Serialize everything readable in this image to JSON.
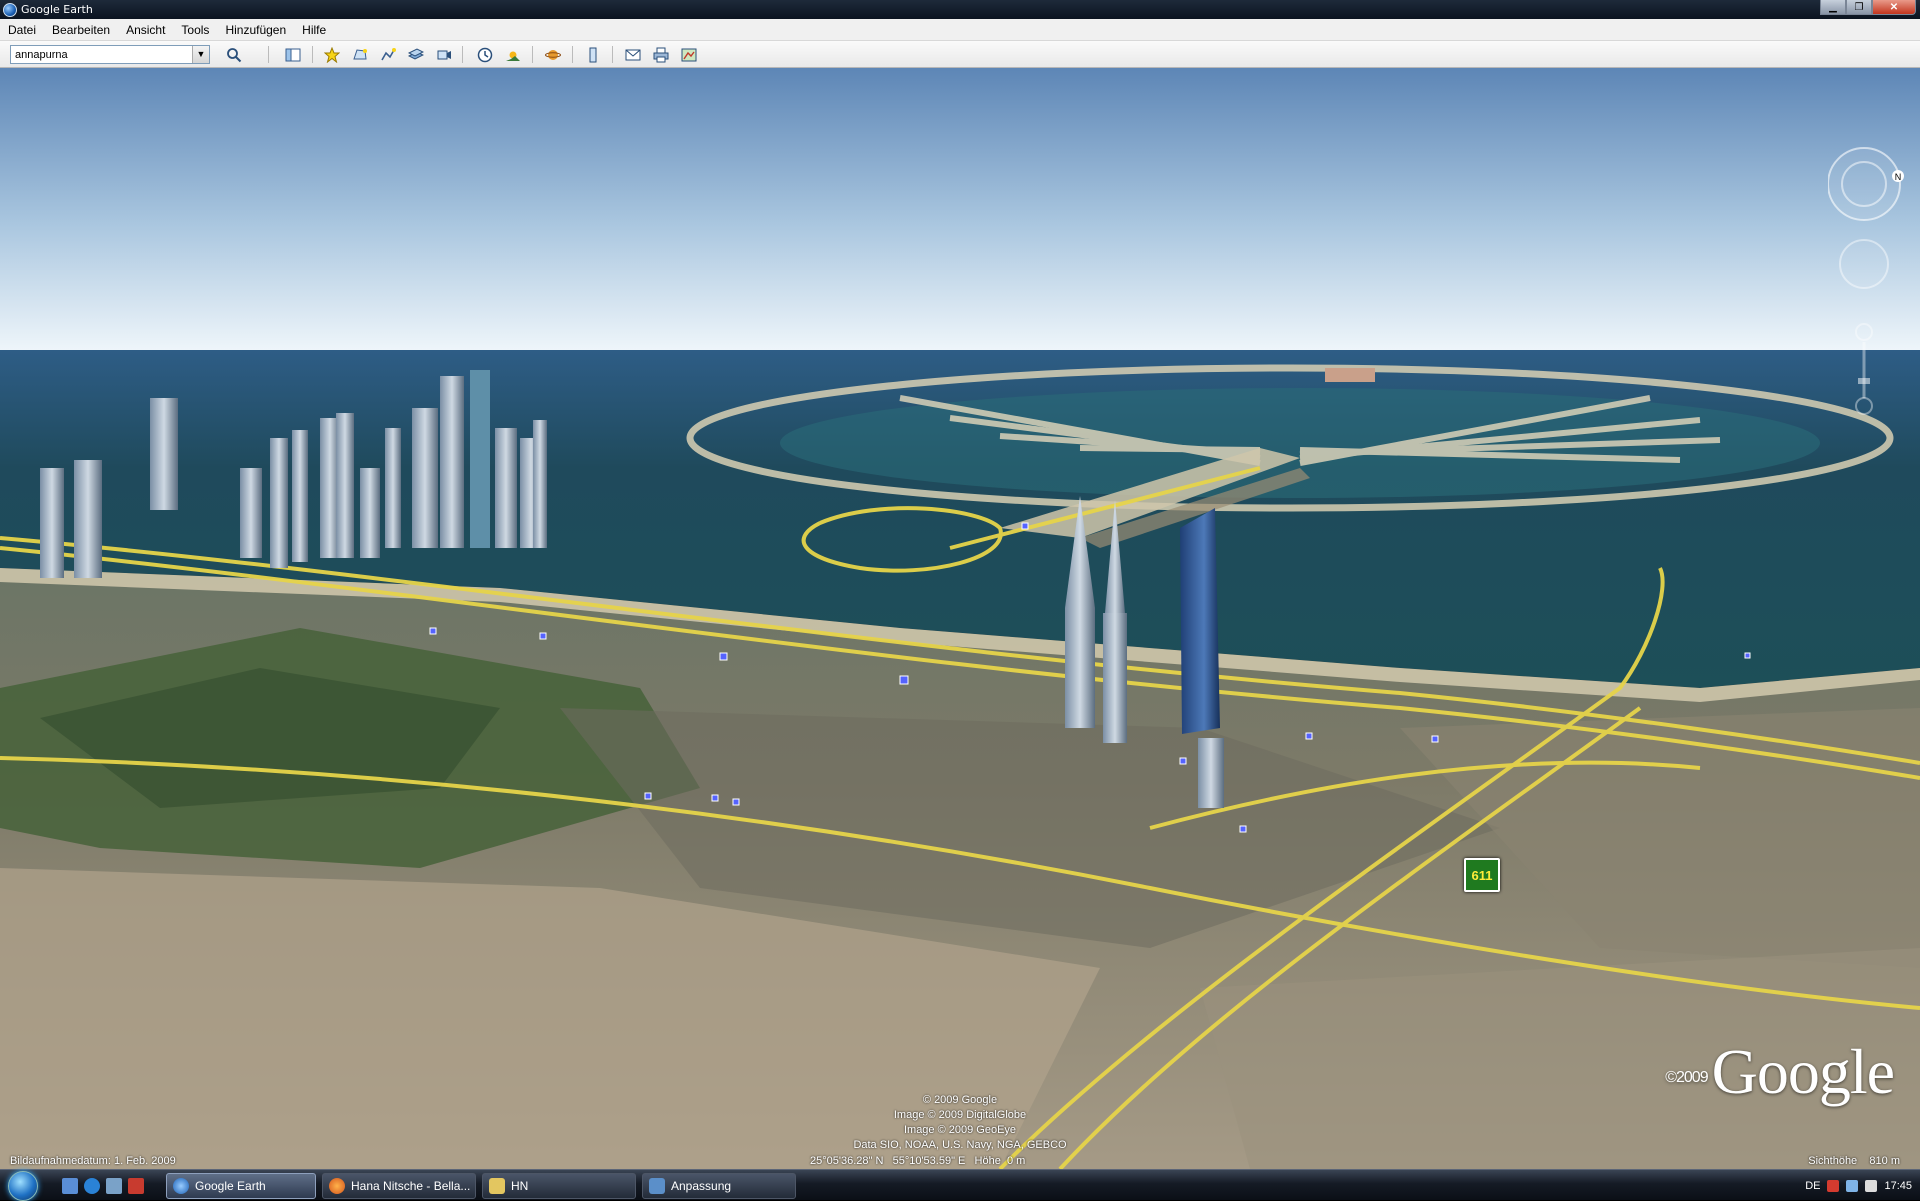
{
  "window": {
    "title": "Google Earth",
    "buttons": {
      "minimize": "▁",
      "restore": "❐",
      "close": "✕"
    }
  },
  "menu": [
    "Datei",
    "Bearbeiten",
    "Ansicht",
    "Tools",
    "Hinzufügen",
    "Hilfe"
  ],
  "search": {
    "value": "annapurna",
    "placeholder": ""
  },
  "toolbar_icons": [
    "search-icon",
    "sidebar-icon",
    "placemark-icon",
    "polygon-icon",
    "path-icon",
    "overlay-icon",
    "record-tour-icon",
    "historical-imagery-icon",
    "sunlight-icon",
    "planet-icon",
    "ruler-icon",
    "email-icon",
    "print-icon",
    "view-in-maps-icon"
  ],
  "map": {
    "attribution": [
      "© 2009 Google",
      "Image © 2009 DigitalGlobe",
      "Image © 2009 GeoEye",
      "Data SIO, NOAA, U.S. Navy, NGA, GEBCO"
    ],
    "imagery_date_label": "Bildaufnahmedatum:",
    "imagery_date": "1. Feb. 2009",
    "latitude": "25°05'36.28\" N",
    "longitude": "55°10'53.59\" E",
    "elevation_label": "Höhe",
    "elevation": "0 m",
    "eye_alt_label": "Sichthöhe",
    "eye_alt": "810 m",
    "logo_year": "©2009",
    "logo": "Google",
    "road_sign": "611",
    "compass_north": "N",
    "colors": {
      "sky_top": "#5d86b6",
      "sky_horizon": "#e8f2f8",
      "sea": "#1f4a5c",
      "road": "#e6d44a",
      "desert": "#a79a84"
    }
  },
  "taskbar": {
    "items": [
      {
        "label": "Google Earth",
        "active": true
      },
      {
        "label": "Hana Nitsche - Bella...",
        "active": false
      },
      {
        "label": "HN",
        "active": false
      },
      {
        "label": "Anpassung",
        "active": false
      }
    ],
    "language": "DE",
    "clock": "17:45"
  }
}
